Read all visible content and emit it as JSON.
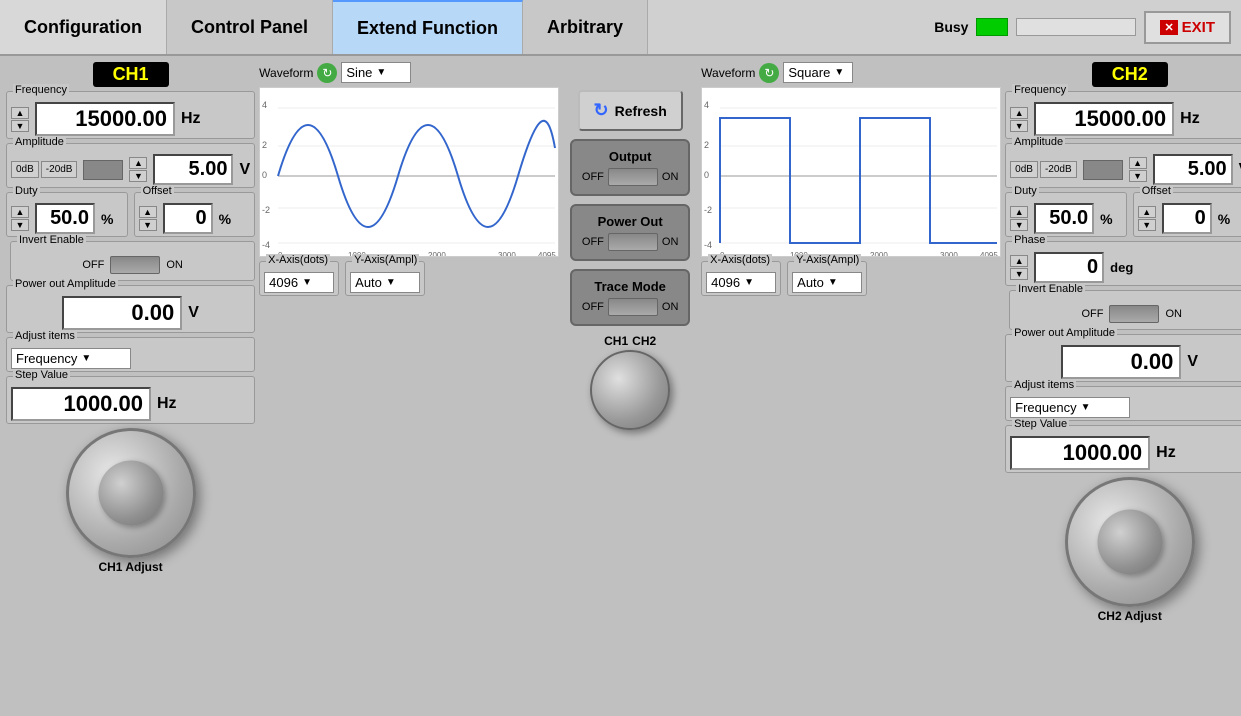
{
  "nav": {
    "tabs": [
      {
        "label": "Configuration",
        "active": false
      },
      {
        "label": "Control Panel",
        "active": false
      },
      {
        "label": "Extend Function",
        "active": true
      },
      {
        "label": "Arbitrary",
        "active": false
      }
    ],
    "busy_label": "Busy",
    "exit_label": "EXIT"
  },
  "ch1": {
    "label": "CH1",
    "frequency_label": "Frequency",
    "frequency_value": "15000.00",
    "frequency_unit": "Hz",
    "amplitude_label": "Amplitude",
    "amplitude_value": "5.00",
    "amplitude_unit": "V",
    "db_0": "0dB",
    "db_20": "-20dB",
    "duty_label": "Duty",
    "duty_value": "50.0",
    "duty_unit": "%",
    "offset_label": "Offset",
    "offset_value": "0",
    "offset_unit": "%",
    "waveform_label": "Waveform",
    "waveform_value": "Sine",
    "xaxis_label": "X-Axis(dots)",
    "xaxis_value": "4096",
    "yaxis_label": "Y-Axis(Ampl)",
    "yaxis_value": "Auto",
    "invert_label": "Invert Enable",
    "invert_off": "OFF",
    "invert_on": "ON",
    "power_amp_label": "Power out Amplitude",
    "power_amp_value": "0.00",
    "power_amp_unit": "V",
    "adjust_label": "Adjust items",
    "adjust_value": "Frequency",
    "step_label": "Step Value",
    "step_value": "1000.00",
    "step_unit": "Hz",
    "adjust_ch_label": "CH1 Adjust"
  },
  "ch2": {
    "label": "CH2",
    "frequency_label": "Frequency",
    "frequency_value": "15000.00",
    "frequency_unit": "Hz",
    "amplitude_label": "Amplitude",
    "amplitude_value": "5.00",
    "amplitude_unit": "V",
    "db_0": "0dB",
    "db_20": "-20dB",
    "duty_label": "Duty",
    "duty_value": "50.0",
    "duty_unit": "%",
    "offset_label": "Offset",
    "offset_value": "0",
    "offset_unit": "%",
    "waveform_label": "Waveform",
    "waveform_value": "Square",
    "xaxis_label": "X-Axis(dots)",
    "xaxis_value": "4096",
    "yaxis_label": "Y-Axis(Ampl)",
    "yaxis_value": "Auto",
    "phase_label": "Phase",
    "phase_value": "0",
    "phase_unit": "deg",
    "invert_label": "Invert Enable",
    "invert_off": "OFF",
    "invert_on": "ON",
    "power_amp_label": "Power out Amplitude",
    "power_amp_value": "0.00",
    "power_amp_unit": "V",
    "adjust_label": "Adjust items",
    "adjust_value": "Frequency",
    "step_label": "Step Value",
    "step_value": "1000.00",
    "step_unit": "Hz",
    "adjust_ch_label": "CH2 Adjust"
  },
  "center": {
    "refresh_label": "Refresh",
    "output_label": "Output",
    "output_off": "OFF",
    "output_on": "ON",
    "power_out_label": "Power Out",
    "power_out_off": "OFF",
    "power_out_on": "ON",
    "trace_label": "Trace Mode",
    "trace_off": "OFF",
    "trace_on": "ON",
    "ch1_label": "CH1",
    "ch2_label": "CH2"
  }
}
